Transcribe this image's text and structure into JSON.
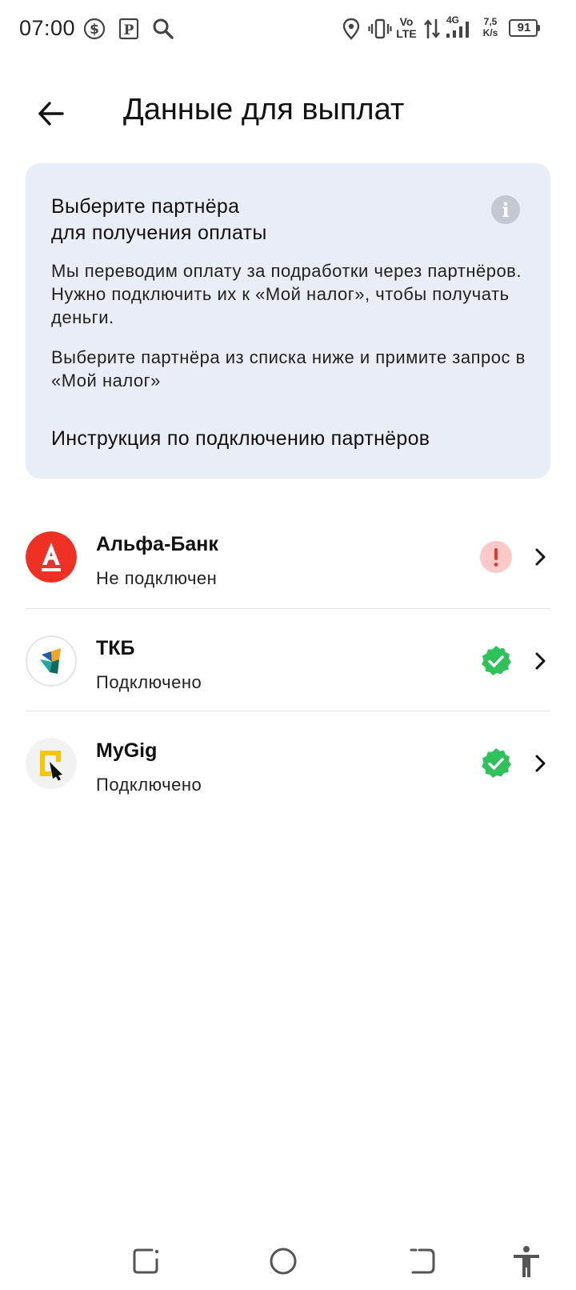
{
  "status_bar": {
    "time": "07:00",
    "network_speed_value": "7,5",
    "network_speed_unit": "K/s",
    "volte_top": "Vo",
    "volte_bottom": "LTE",
    "network_type": "4G",
    "battery": "91",
    "icons": [
      "dollar-icon",
      "parking-icon",
      "search-icon",
      "location-icon",
      "vibrate-icon",
      "data-arrows-icon",
      "signal-icon",
      "battery-icon"
    ]
  },
  "header": {
    "title": "Данные для выплат"
  },
  "info_card": {
    "title": "Выберите партнёра\nдля получения оплаты",
    "paragraph1": "Мы переводим оплату за подработки через партнёров. Нужно подключить их к «Мой налог», чтобы получать деньги.",
    "paragraph2": "Выберите партнёра из списка ниже и примите запрос в «Мой налог»",
    "link": "Инструкция по подключению партнёров"
  },
  "partners": [
    {
      "name": "Альфа-Банк",
      "status": "Не подключен",
      "state": "warning"
    },
    {
      "name": "ТКБ",
      "status": "Подключено",
      "state": "connected"
    },
    {
      "name": "MyGig",
      "status": "Подключено",
      "state": "connected"
    }
  ],
  "colors": {
    "card_bg": "#e9edf5",
    "alfa_red": "#ef3124",
    "warning_bg": "#fdc8c8",
    "warning_fg": "#e53935",
    "success": "#2fc25b",
    "mygig_yellow": "#f7c600"
  },
  "nav_bar": {
    "icons": [
      "recent-apps-icon",
      "home-icon",
      "back-nav-icon",
      "accessibility-icon"
    ]
  }
}
